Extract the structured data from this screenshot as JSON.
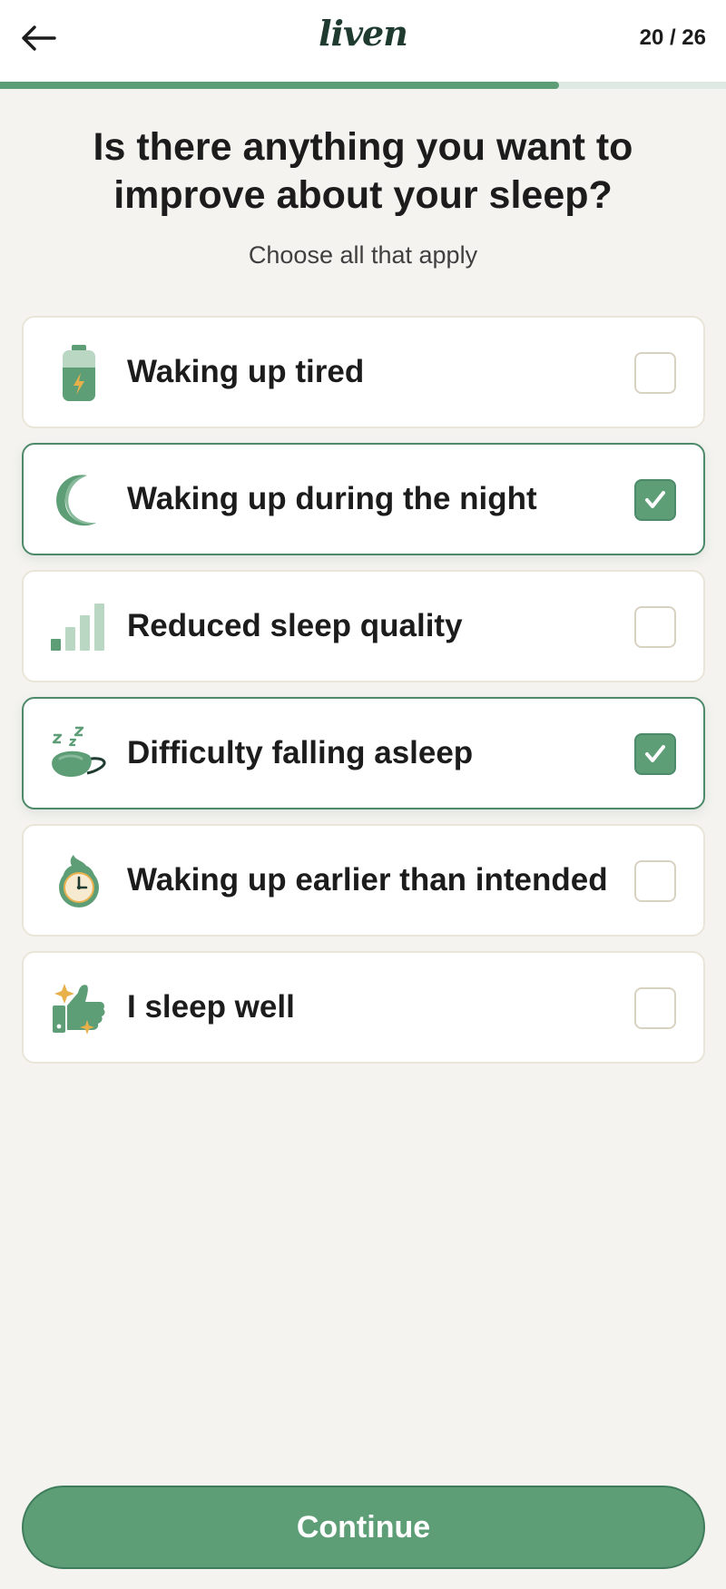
{
  "header": {
    "logo": "liven",
    "step": "20 / 26",
    "progress_fraction": 0.77
  },
  "question": {
    "title": "Is there anything you want to improve about your sleep?",
    "subtitle": "Choose all that apply"
  },
  "options": [
    {
      "label": "Waking up tired",
      "icon": "battery-icon",
      "selected": false
    },
    {
      "label": "Waking up during the night",
      "icon": "moon-icon",
      "selected": true
    },
    {
      "label": "Reduced sleep quality",
      "icon": "signal-bars-icon",
      "selected": false
    },
    {
      "label": "Difficulty falling asleep",
      "icon": "sleep-mask-icon",
      "selected": true
    },
    {
      "label": "Waking up earlier than intended",
      "icon": "alarm-clock-icon",
      "selected": false
    },
    {
      "label": "I sleep well",
      "icon": "thumbs-up-icon",
      "selected": false
    }
  ],
  "footer": {
    "continue_label": "Continue"
  },
  "colors": {
    "accent": "#5e9e77",
    "accent_dark": "#4d8a69",
    "background": "#f4f3f0",
    "gold": "#e8b04b"
  }
}
